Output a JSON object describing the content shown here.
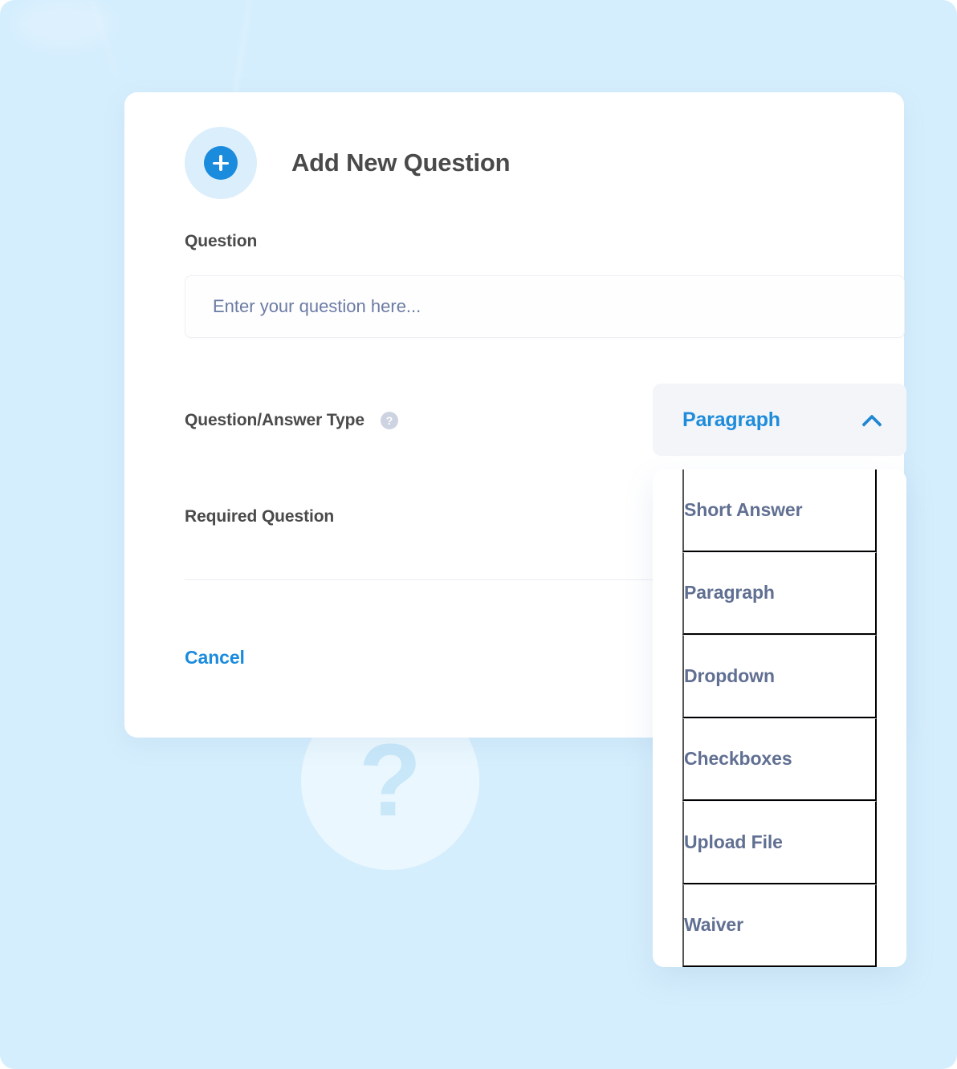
{
  "theme": {
    "page_background": "#d5eefd",
    "card_background": "#ffffff",
    "accent_blue": "#1b8bdd",
    "dropdown_value_blue": "#1f8cdb",
    "label_gray": "#4a4a4a",
    "menu_item_slate": "#606f92",
    "trigger_background": "#f3f5f9",
    "badge_background": "#dbeefc",
    "help_icon_background": "#cdd3e0"
  },
  "card": {
    "icon_name": "plus-circle-icon",
    "title": "Add New Question",
    "fields": {
      "question": {
        "label": "Question",
        "placeholder": "Enter your question here...",
        "value": ""
      },
      "qa_type": {
        "label": "Question/Answer Type",
        "help_icon_name": "help-question-mark-icon",
        "help_glyph": "?"
      },
      "required_question": {
        "label": "Required Question"
      }
    },
    "actions": {
      "cancel_label": "Cancel"
    }
  },
  "dropdown": {
    "selected": "Paragraph",
    "expanded": true,
    "chevron_icon_name": "chevron-up-icon",
    "options": [
      {
        "label": "Short Answer"
      },
      {
        "label": "Paragraph"
      },
      {
        "label": "Dropdown"
      },
      {
        "label": "Checkboxes"
      },
      {
        "label": "Upload File"
      },
      {
        "label": "Waiver"
      }
    ]
  },
  "decoration": {
    "watermark_glyph": "?"
  }
}
